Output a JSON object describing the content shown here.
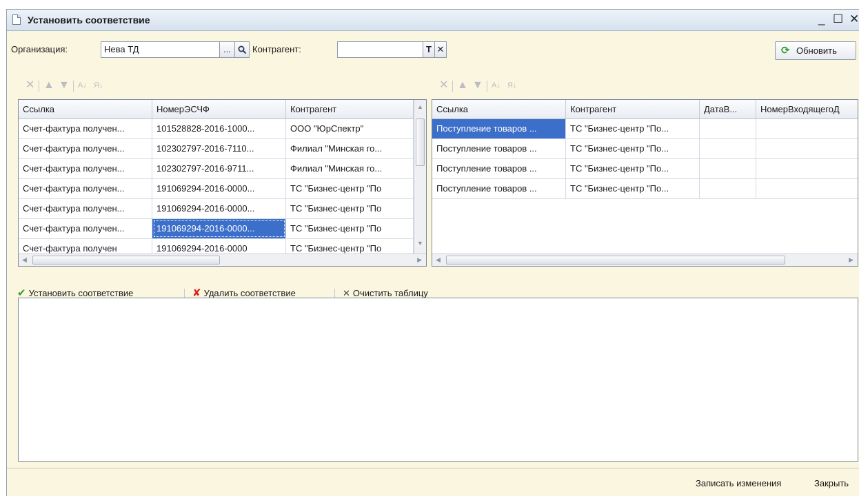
{
  "window": {
    "title": "Установить соответствие",
    "minimize": "_",
    "maximize": "☐",
    "close": "✕"
  },
  "filters": {
    "organization_label": "Организация:",
    "organization_value": "Нева ТД",
    "organization_choose": "...",
    "counterparty_label": "Контрагент:",
    "counterparty_value": "",
    "counterparty_t": "T",
    "counterparty_clear": "✕",
    "refresh_label": "Обновить"
  },
  "left_table": {
    "columns": [
      "Ссылка",
      "НомерЭСЧФ",
      "Контрагент"
    ],
    "rows": [
      [
        "Счет-фактура получен...",
        "101528828-2016-1000...",
        "ООО \"ЮрСпектр\""
      ],
      [
        "Счет-фактура получен...",
        "102302797-2016-7110...",
        "Филиал \"Минская го..."
      ],
      [
        "Счет-фактура получен...",
        "102302797-2016-9711...",
        "Филиал \"Минская го..."
      ],
      [
        "Счет-фактура получен...",
        "191069294-2016-0000...",
        "ТС \"Бизнес-центр \"По"
      ],
      [
        "Счет-фактура получен...",
        "191069294-2016-0000...",
        "ТС \"Бизнес-центр \"По"
      ],
      [
        "Счет-фактура получен...",
        "191069294-2016-0000...",
        "ТС \"Бизнес-центр \"По"
      ],
      [
        "Счет-фактура получен",
        "191069294-2016-0000",
        "ТС \"Бизнес-центр \"По"
      ]
    ]
  },
  "right_table": {
    "columns": [
      "Ссылка",
      "Контрагент",
      "ДатаВ...",
      "НомерВходящегоД"
    ],
    "rows": [
      [
        "Поступление товаров ...",
        "ТС \"Бизнес-центр \"По...",
        "",
        ""
      ],
      [
        "Поступление товаров ...",
        "ТС \"Бизнес-центр \"По...",
        "",
        ""
      ],
      [
        "Поступление товаров ...",
        "ТС \"Бизнес-центр \"По...",
        "",
        ""
      ],
      [
        "Поступление товаров ...",
        "ТС \"Бизнес-центр \"По...",
        "",
        ""
      ]
    ]
  },
  "actions": {
    "set_match": "Установить соответствие",
    "delete_match": "Удалить соответствие",
    "clear_table": "Очистить таблицу"
  },
  "footer": {
    "save_changes": "Записать изменения",
    "close": "Закрыть"
  },
  "colors": {
    "accent_green": "#2f9a2f",
    "delete_red": "#e02020",
    "selection_blue": "#3c6fc9",
    "form_background": "#fbf6df"
  },
  "icons": {
    "toolbar": [
      "delete-icon",
      "move-up-icon",
      "move-down-icon",
      "sort-ascending-icon",
      "sort-descending-icon"
    ],
    "refresh": "refresh-icon",
    "search": "search-icon"
  }
}
